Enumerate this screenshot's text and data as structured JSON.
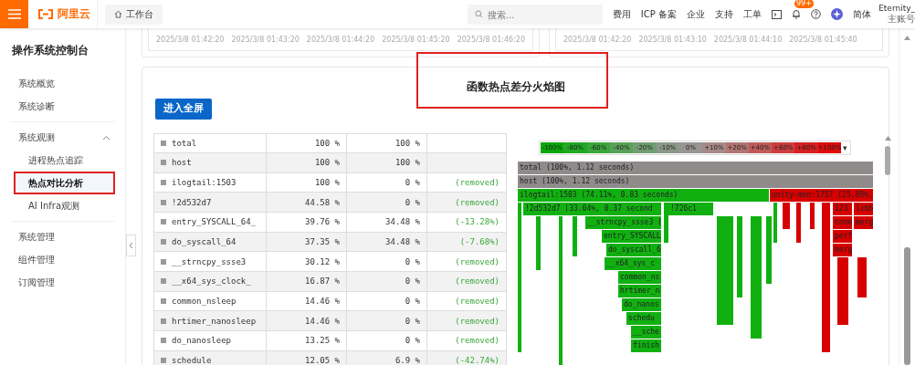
{
  "header": {
    "logo": "阿里云",
    "workbench": "工作台",
    "search": {
      "placeholder": "搜索..."
    },
    "links": [
      "费用",
      "ICP 备案",
      "企业",
      "支持",
      "工单"
    ],
    "notification_badge": "99+",
    "language": "简体",
    "account": {
      "name": "Eternity_",
      "role": "主账号"
    }
  },
  "sidebar": {
    "title": "操作系统控制台",
    "items": [
      {
        "label": "系统概览",
        "selected": false
      },
      {
        "label": "系统诊断",
        "selected": false
      },
      {
        "label": "系统观测",
        "selected": false,
        "expanded": true,
        "children": [
          {
            "label": "进程热点追踪",
            "selected": false
          },
          {
            "label": "热点对比分析",
            "selected": true
          },
          {
            "label": "AI Infra观测",
            "selected": false
          }
        ]
      },
      {
        "label": "系统管理",
        "selected": false
      },
      {
        "label": "组件管理",
        "selected": false
      },
      {
        "label": "订阅管理",
        "selected": false
      }
    ]
  },
  "timeline_cards": [
    {
      "ticks": [
        "2025/3/8 01:42:20",
        "2025/3/8 01:43:20",
        "2025/3/8 01:44:20",
        "2025/3/8 01:45:20",
        "2025/3/8 01:46:20"
      ]
    },
    {
      "ticks": [
        "2025/3/8 01:42:20",
        "2025/3/8 01:43:10",
        "2025/3/8 01:44:10",
        "2025/3/8 01:45:40"
      ]
    }
  ],
  "chart_title": {
    "text": "函数热点差分火焰图",
    "highlighted": true
  },
  "fullscreen_button": "进入全屏",
  "table": {
    "rows": [
      {
        "name": "total",
        "base": "100 %",
        "compare": "100 %"
      },
      {
        "name": "host",
        "base": "100 %",
        "compare": "100 %"
      },
      {
        "name": "ilogtail:1503",
        "base": "100 %",
        "compare": "0 %",
        "diff": "(removed)"
      },
      {
        "name": "!2d532d7",
        "base": "44.58 %",
        "compare": "0 %",
        "diff": "(removed)"
      },
      {
        "name": "entry_SYSCALL_64_",
        "base": "39.76 %",
        "compare": "34.48 %",
        "diff": "(-13.28%)"
      },
      {
        "name": "do_syscall_64",
        "base": "37.35 %",
        "compare": "34.48 %",
        "diff": "(-7.68%)"
      },
      {
        "name": "__strncpy_ssse3",
        "base": "30.12 %",
        "compare": "0 %",
        "diff": "(removed)"
      },
      {
        "name": "__x64_sys_clock_",
        "base": "16.87 %",
        "compare": "0 %",
        "diff": "(removed)"
      },
      {
        "name": "common_nsleep",
        "base": "14.46 %",
        "compare": "0 %",
        "diff": "(removed)"
      },
      {
        "name": "hrtimer_nanosleep",
        "base": "14.46 %",
        "compare": "0 %",
        "diff": "(removed)"
      },
      {
        "name": "do_nanosleep",
        "base": "13.25 %",
        "compare": "0 %",
        "diff": "(removed)"
      },
      {
        "name": "schedule",
        "base": "12.05 %",
        "compare": "6.9 %",
        "diff": "(-42.74%)"
      }
    ]
  },
  "legend": {
    "steps": [
      {
        "label": "-100%",
        "color": "#0aa80a"
      },
      {
        "label": "-80%",
        "color": "#22a822"
      },
      {
        "label": "-60%",
        "color": "#3ba63b"
      },
      {
        "label": "-40%",
        "color": "#58a258"
      },
      {
        "label": "-20%",
        "color": "#729d72"
      },
      {
        "label": "-10%",
        "color": "#8a988a"
      },
      {
        "label": "0%",
        "color": "#999595"
      },
      {
        "label": "+10%",
        "color": "#a88a8a"
      },
      {
        "label": "+20%",
        "color": "#b27474"
      },
      {
        "label": "+40%",
        "color": "#c05a5a"
      },
      {
        "label": "+60%",
        "color": "#cc3d3d"
      },
      {
        "label": "+80%",
        "color": "#d82020"
      },
      {
        "label": "+100%",
        "color": "#e00a0a"
      }
    ],
    "menu": "▾"
  },
  "flame_graph": {
    "frames": [
      {
        "label": "total (100%, 1.12 seconds)",
        "kind": "neutral"
      },
      {
        "label": "host (100%, 1.12 seconds)",
        "kind": "neutral"
      },
      {
        "label": "ilogtail:1503 (74.11%, 0.83 seconds)",
        "kind": "removed"
      },
      {
        "label": "unity-mon:1757 (25.89%,",
        "kind": "added"
      },
      {
        "label": "!2d532d7 (33.04%, 0.37 second",
        "kind": "removed"
      },
      {
        "label": "!726c1",
        "kind": "removed"
      },
      {
        "label": "123",
        "kind": "added"
      },
      {
        "label": "libb",
        "kind": "added"
      },
      {
        "label": "__strncpy_ssse3 (",
        "kind": "removed"
      },
      {
        "label": "conn",
        "kind": "added"
      },
      {
        "label": "merg",
        "kind": "added"
      },
      {
        "label": "entry_SYSCALL",
        "kind": "removed"
      },
      {
        "label": "perf",
        "kind": "added"
      },
      {
        "label": "do_syscall_6",
        "kind": "removed"
      },
      {
        "label": "merg",
        "kind": "added"
      },
      {
        "label": "__x64_sys_c",
        "kind": "removed"
      },
      {
        "label": "common_ns",
        "kind": "removed"
      },
      {
        "label": "hrtimer_n",
        "kind": "removed"
      },
      {
        "label": "do_nanos",
        "kind": "removed"
      },
      {
        "label": "schedu",
        "kind": "removed"
      },
      {
        "label": "__sche",
        "kind": "removed"
      },
      {
        "label": "finish",
        "kind": "removed"
      }
    ]
  }
}
